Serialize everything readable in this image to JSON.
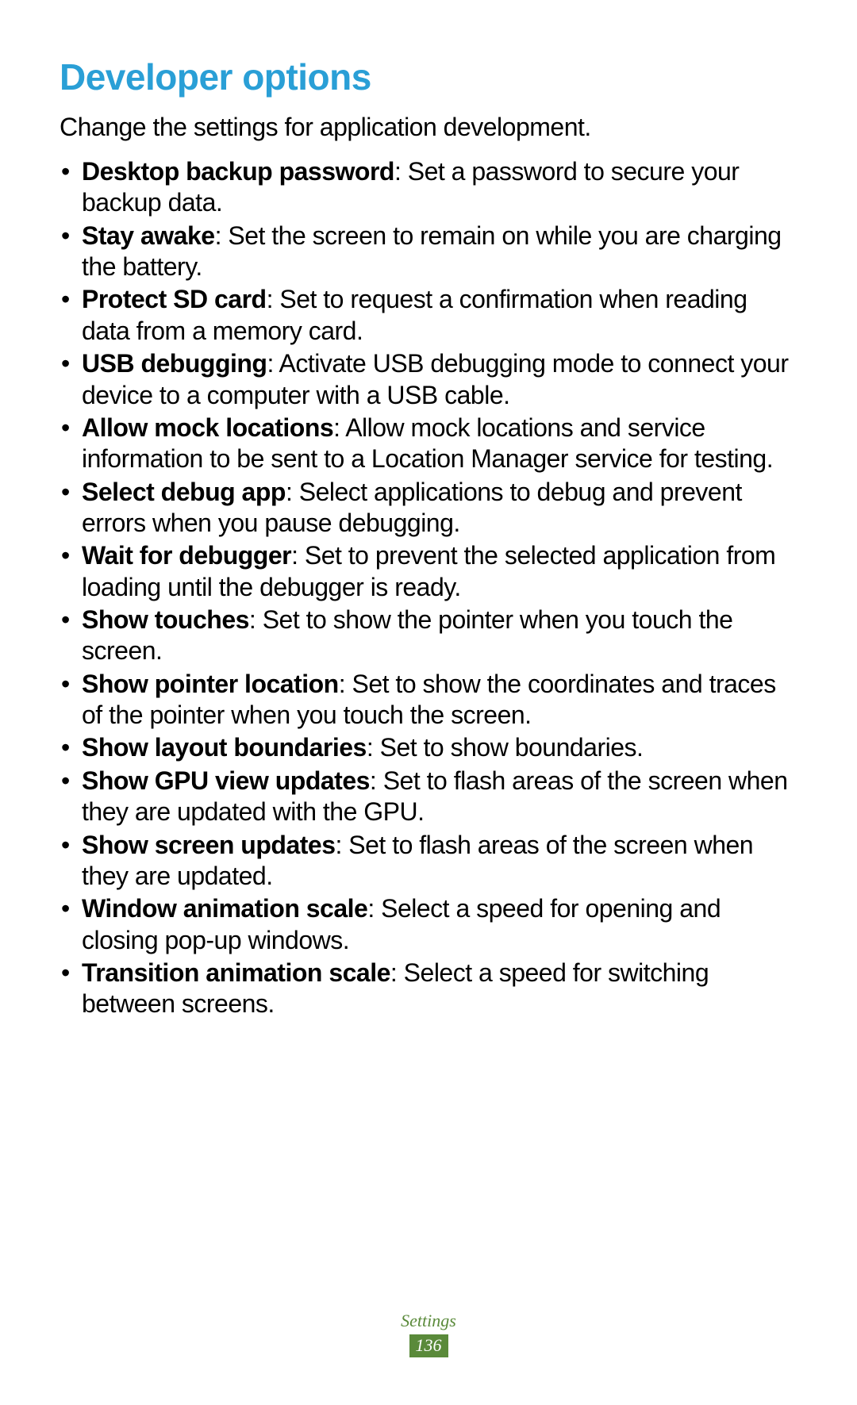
{
  "heading": "Developer options",
  "intro": "Change the settings for application development.",
  "items": [
    {
      "term": "Desktop backup password",
      "desc": ": Set a password to secure your backup data."
    },
    {
      "term": "Stay awake",
      "desc": ": Set the screen to remain on while you are charging the battery."
    },
    {
      "term": "Protect SD card",
      "desc": ": Set to request a confirmation when reading data from a memory card."
    },
    {
      "term": "USB debugging",
      "desc": ": Activate USB debugging mode to connect your device to a computer with a USB cable."
    },
    {
      "term": "Allow mock locations",
      "desc": ": Allow mock locations and service information to be sent to a Location Manager service for testing."
    },
    {
      "term": "Select debug app",
      "desc": ": Select applications to debug and prevent errors when you pause debugging."
    },
    {
      "term": "Wait for debugger",
      "desc": ": Set to prevent the selected application from loading until the debugger is ready."
    },
    {
      "term": "Show touches",
      "desc": ": Set to show the pointer when you touch the screen."
    },
    {
      "term": "Show pointer location",
      "desc": ": Set to show the coordinates and traces of the pointer when you touch the screen."
    },
    {
      "term": "Show layout boundaries",
      "desc": ": Set to show boundaries."
    },
    {
      "term": "Show GPU view updates",
      "desc": ": Set to flash areas of the screen when they are updated with the GPU."
    },
    {
      "term": "Show screen updates",
      "desc": ": Set to flash areas of the screen when they are updated."
    },
    {
      "term": "Window animation scale",
      "desc": ": Select a speed for opening and closing pop-up windows."
    },
    {
      "term": "Transition animation scale",
      "desc": ": Select a speed for switching between screens."
    }
  ],
  "footer": {
    "section": "Settings",
    "page": "136"
  }
}
